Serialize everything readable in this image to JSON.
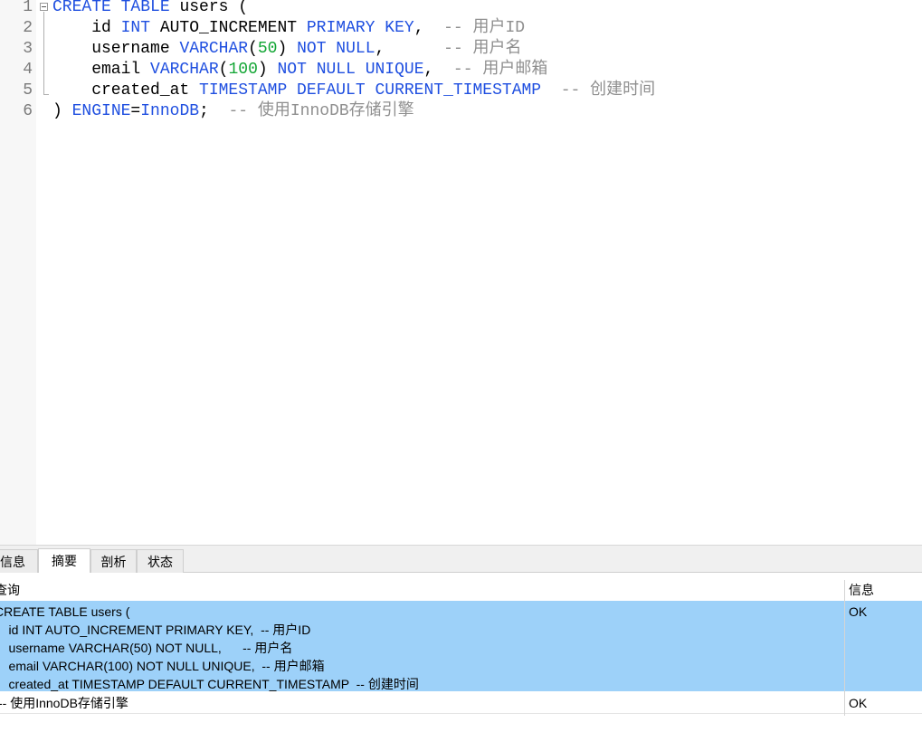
{
  "editor": {
    "line_numbers": [
      "1",
      "2",
      "3",
      "4",
      "5",
      "6"
    ],
    "lines": [
      [
        {
          "t": "CREATE",
          "c": "kw"
        },
        {
          "t": " ",
          "c": "pl"
        },
        {
          "t": "TABLE",
          "c": "kw"
        },
        {
          "t": " users (",
          "c": "pl"
        }
      ],
      [
        {
          "t": "    id ",
          "c": "pl"
        },
        {
          "t": "INT",
          "c": "kw"
        },
        {
          "t": " AUTO_INCREMENT ",
          "c": "pl"
        },
        {
          "t": "PRIMARY KEY",
          "c": "kw"
        },
        {
          "t": ",  ",
          "c": "pl"
        },
        {
          "t": "-- 用户ID",
          "c": "cm"
        }
      ],
      [
        {
          "t": "    username ",
          "c": "pl"
        },
        {
          "t": "VARCHAR",
          "c": "kw"
        },
        {
          "t": "(",
          "c": "pl"
        },
        {
          "t": "50",
          "c": "num"
        },
        {
          "t": ") ",
          "c": "pl"
        },
        {
          "t": "NOT NULL",
          "c": "kw"
        },
        {
          "t": ",      ",
          "c": "pl"
        },
        {
          "t": "-- 用户名",
          "c": "cm"
        }
      ],
      [
        {
          "t": "    email ",
          "c": "pl"
        },
        {
          "t": "VARCHAR",
          "c": "kw"
        },
        {
          "t": "(",
          "c": "pl"
        },
        {
          "t": "100",
          "c": "num"
        },
        {
          "t": ") ",
          "c": "pl"
        },
        {
          "t": "NOT NULL UNIQUE",
          "c": "kw"
        },
        {
          "t": ",  ",
          "c": "pl"
        },
        {
          "t": "-- 用户邮箱",
          "c": "cm"
        }
      ],
      [
        {
          "t": "    created_at ",
          "c": "pl"
        },
        {
          "t": "TIMESTAMP DEFAULT CURRENT_TIMESTAMP",
          "c": "kw"
        },
        {
          "t": "  ",
          "c": "pl"
        },
        {
          "t": "-- 创建时间",
          "c": "cm"
        }
      ],
      [
        {
          "t": ") ",
          "c": "pl"
        },
        {
          "t": "ENGINE",
          "c": "kw"
        },
        {
          "t": "=",
          "c": "pl"
        },
        {
          "t": "InnoDB",
          "c": "kw"
        },
        {
          "t": ";  ",
          "c": "pl"
        },
        {
          "t": "-- 使用InnoDB存储引擎",
          "c": "cm"
        }
      ]
    ]
  },
  "tabs": {
    "info": "信息",
    "summary": "摘要",
    "profile": "剖析",
    "status": "状态"
  },
  "results": {
    "header_query": "查询",
    "header_info": "信息",
    "row1": {
      "lines": [
        "CREATE TABLE users (",
        "    id INT AUTO_INCREMENT PRIMARY KEY,  -- 用户ID",
        "    username VARCHAR(50) NOT NULL,      -- 用户名",
        "    email VARCHAR(100) NOT NULL UNIQUE,  -- 用户邮箱",
        "    created_at TIMESTAMP DEFAULT CURRENT_TIMESTAMP  -- 创建时间"
      ],
      "status": "OK"
    },
    "row2": {
      "text": "-- 使用InnoDB存储引擎",
      "status": "OK"
    }
  },
  "colors": {
    "keyword": "#1f4fe0",
    "number": "#11a533",
    "comment": "#8f8f8f",
    "selection": "#9dd1f9"
  }
}
